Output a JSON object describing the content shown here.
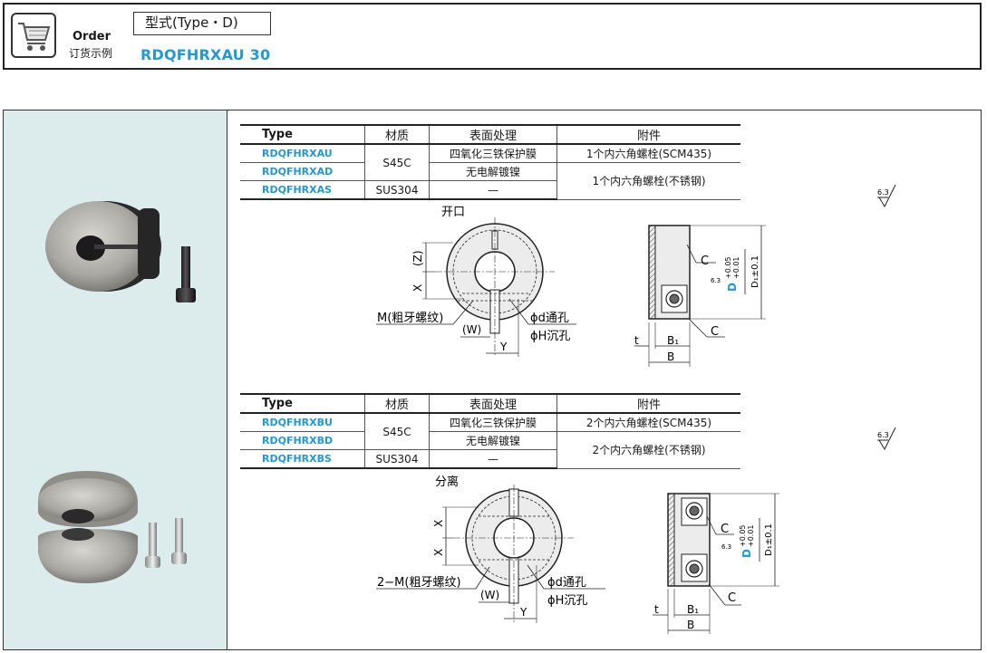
{
  "order": {
    "label_en": "Order",
    "label_zh": "订货示例",
    "type_label": "型式(Type・D)",
    "example_code": "RDQFHRXAU 30",
    "cart_icon": "shopping-cart-icon"
  },
  "tables": [
    {
      "headers": [
        "Type",
        "材质",
        "表面处理",
        "附件"
      ],
      "rows": [
        {
          "code": "RDQFHRXAU",
          "material": "S45C",
          "surface": "四氧化三铁保护膜",
          "accessory": "1个内六角螺栓(SCM435)"
        },
        {
          "code": "RDQFHRXAD",
          "material": "",
          "surface": "无电解镀镍",
          "accessory": "1个内六角螺栓(不锈钢)"
        },
        {
          "code": "RDQFHRXAS",
          "material": "SUS304",
          "surface": "—",
          "accessory": ""
        }
      ]
    },
    {
      "headers": [
        "Type",
        "材质",
        "表面处理",
        "附件"
      ],
      "rows": [
        {
          "code": "RDQFHRXBU",
          "material": "S45C",
          "surface": "四氧化三铁保护膜",
          "accessory": "2个内六角螺栓(SCM435)"
        },
        {
          "code": "RDQFHRXBD",
          "material": "",
          "surface": "无电解镀镍",
          "accessory": "2个内六角螺栓(不锈钢)"
        },
        {
          "code": "RDQFHRXBS",
          "material": "SUS304",
          "surface": "—",
          "accessory": ""
        }
      ]
    }
  ],
  "drawing_1": {
    "title": "开口",
    "thread_label": "M(粗牙螺纹)",
    "w_label": "(W)",
    "z_label": "(Z)",
    "x_label": "X",
    "y_label": "Y",
    "d_hole": "ϕd通孔",
    "h_hole": "ϕH沉孔",
    "c_label": "C",
    "t_label": "t",
    "b1_label": "B₁",
    "b_label": "B",
    "d_tol": "D",
    "d_tol_up": "+0.05",
    "d_tol_lo": "+0.01",
    "d1_label": "D₁±0.1",
    "roughness": "6.3"
  },
  "drawing_2": {
    "title": "分离",
    "thread_label": "2−M(粗牙螺纹)",
    "w_label": "(W)",
    "x_label": "X",
    "y_label": "Y",
    "d_hole": "ϕd通孔",
    "h_hole": "ϕH沉孔",
    "c_label": "C",
    "t_label": "t",
    "b1_label": "B₁",
    "b_label": "B",
    "d_tol": "D",
    "d_tol_up": "+0.05",
    "d_tol_lo": "+0.01",
    "d1_label": "D₁±0.1",
    "roughness": "6.3"
  },
  "colors": {
    "accent": "#1f9ad6",
    "panel": "#dcecec",
    "line": "#222222"
  }
}
